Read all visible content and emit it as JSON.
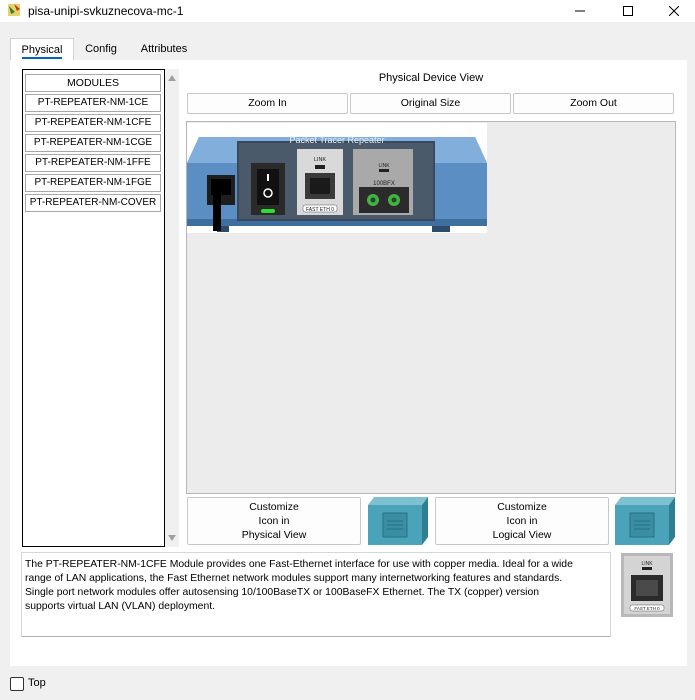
{
  "window": {
    "title": "pisa-unipi-svkuznecova-mc-1",
    "icon": "packet-tracer-icon",
    "controls": [
      "minimize-icon",
      "maximize-icon",
      "close-icon"
    ]
  },
  "tabs": [
    {
      "label": "Physical",
      "active": true
    },
    {
      "label": "Config",
      "active": false
    },
    {
      "label": "Attributes",
      "active": false
    }
  ],
  "modules": {
    "header": "MODULES",
    "items": [
      "PT-REPEATER-NM-1CE",
      "PT-REPEATER-NM-1CFE",
      "PT-REPEATER-NM-1CGE",
      "PT-REPEATER-NM-1FFE",
      "PT-REPEATER-NM-1FGE",
      "PT-REPEATER-NM-COVER"
    ]
  },
  "device_view": {
    "title": "Physical Device View",
    "zoom_in": "Zoom In",
    "original_size": "Original Size",
    "zoom_out": "Zoom Out",
    "device_label": "Packet Tracer Repeater",
    "port1_top": "LINK",
    "port1_bottom": "FAST ETH 0",
    "port2_top": "LINK",
    "port2_speed": "100BFX"
  },
  "customize": {
    "physical": [
      "Customize",
      "Icon in",
      "Physical View"
    ],
    "logical": [
      "Customize",
      "Icon in",
      "Logical View"
    ]
  },
  "description": {
    "lines": [
      "The PT-REPEATER-NM-1CFE Module provides one Fast-Ethernet interface for use with copper media. Ideal for a wide",
      "range of LAN applications, the Fast Ethernet network modules support many internetworking features and standards.",
      "Single port network modules offer autosensing 10/100BaseTX or 100BaseFX Ethernet. The TX (copper) version",
      "supports virtual LAN (VLAN) deployment."
    ]
  },
  "thumbnail": {
    "top": "LINK",
    "bottom": "FAST ETH 0"
  },
  "footer": {
    "top_label": "Top",
    "top_checked": false
  },
  "colors": {
    "accent": "#0067c0",
    "device_blue": "#5b8fc4",
    "led_green": "#2ee02e"
  }
}
